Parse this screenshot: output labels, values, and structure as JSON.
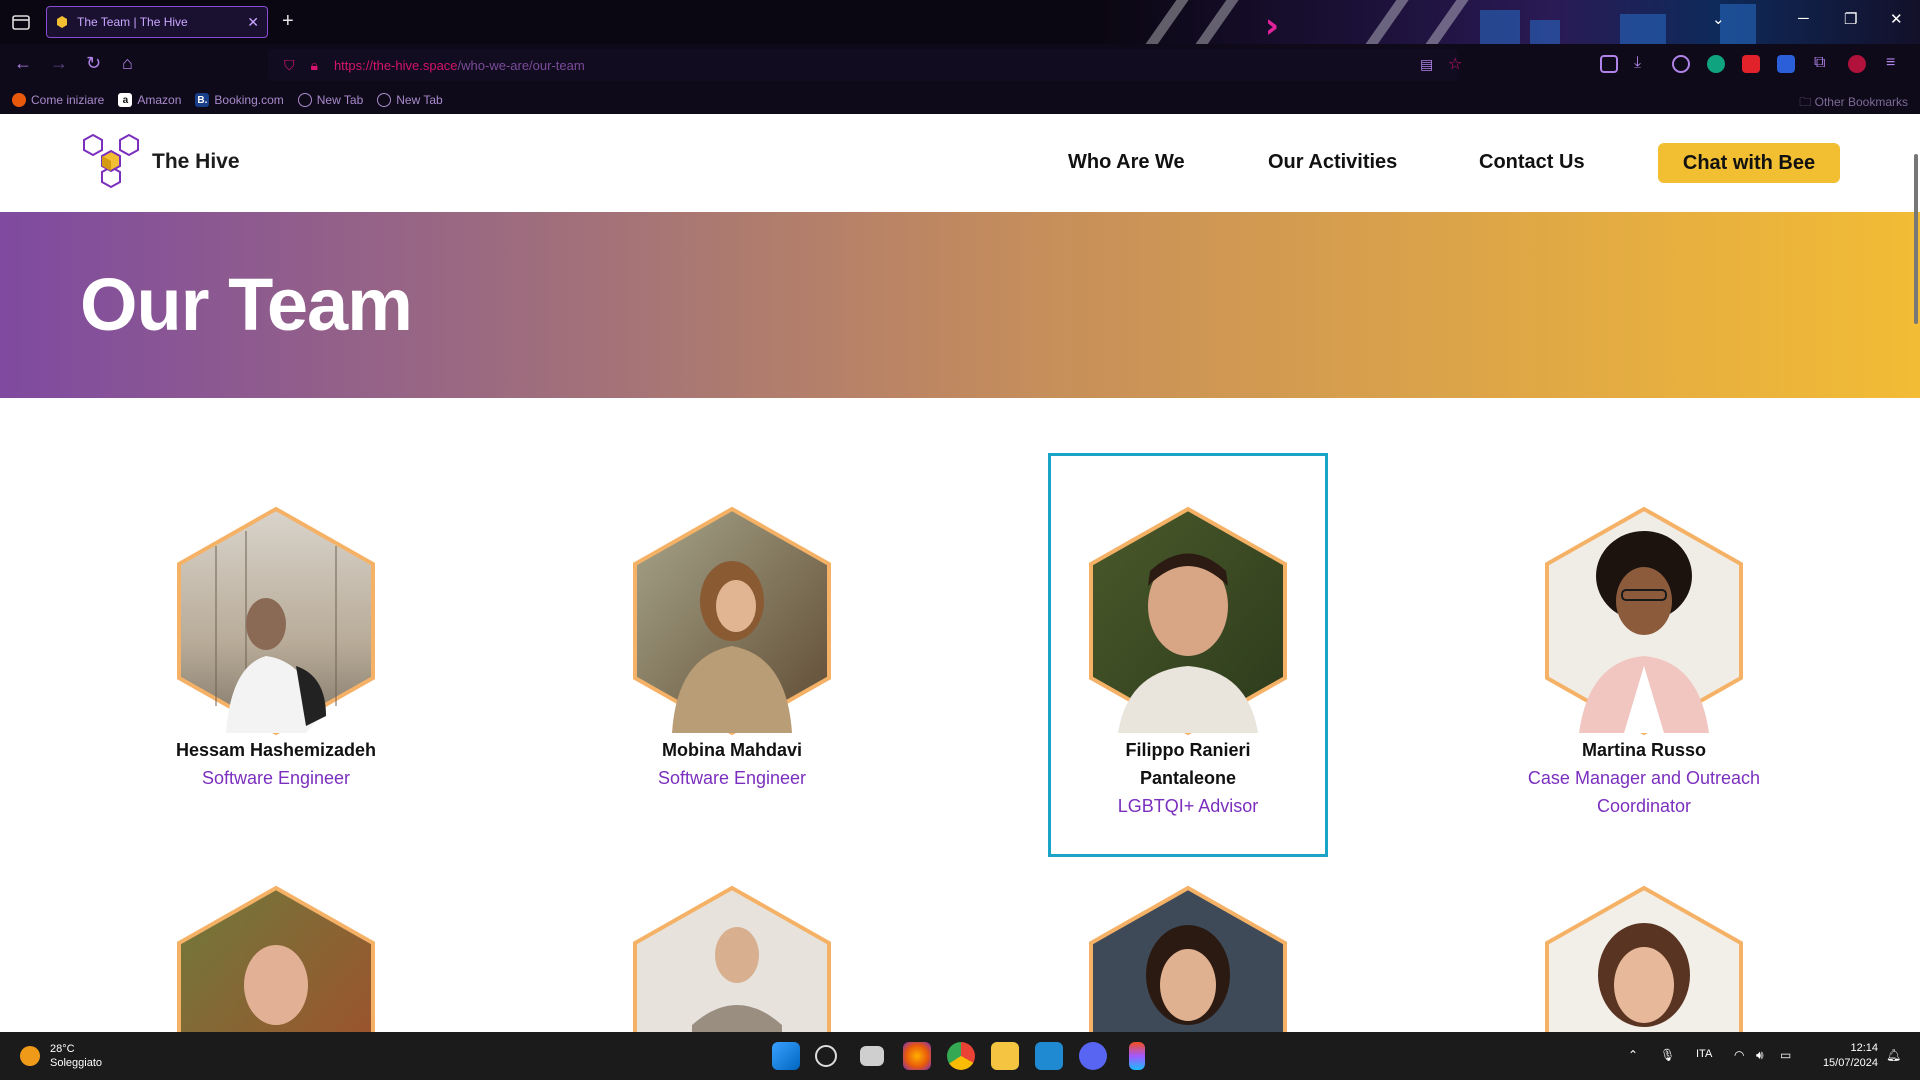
{
  "browser": {
    "tab_title": "The Team | The Hive",
    "tab_close": "✕",
    "new_tab": "+",
    "url_host": "https://the-hive.space",
    "url_path": "/who-we-are/our-team",
    "bookmarks": [
      {
        "label": "Come iniziare",
        "icon": "firefox-icon",
        "icon_char": "",
        "color": "#e8590c"
      },
      {
        "label": "Amazon",
        "icon": "amazon-icon",
        "icon_char": "a",
        "color": "#ffffff"
      },
      {
        "label": "Booking.com",
        "icon": "booking-icon",
        "icon_char": "B.",
        "color": "#1a3f8a"
      },
      {
        "label": "New Tab",
        "icon": "globe-icon",
        "icon_char": "🌐",
        "color": "transparent"
      },
      {
        "label": "New Tab",
        "icon": "globe-icon",
        "icon_char": "🌐",
        "color": "transparent"
      }
    ],
    "other_bookmarks": "Other Bookmarks"
  },
  "site": {
    "logo_text": "The Hive",
    "nav": [
      "Who Are We",
      "Our Activities",
      "Contact Us"
    ],
    "cta": "Chat with Bee",
    "page_title": "Our Team"
  },
  "team": [
    {
      "name": "Hessam Hashemizadeh",
      "role": "Software Engineer"
    },
    {
      "name": "Mobina Mahdavi",
      "role": "Software Engineer"
    },
    {
      "name": "Filippo Ranieri Pantaleone",
      "role": "LGBTQI+ Advisor"
    },
    {
      "name": "Martina Russo",
      "role": "Case Manager and Outreach Coordinator"
    }
  ],
  "taskbar": {
    "temperature": "28°C",
    "weather": "Soleggiato",
    "language": "ITA",
    "time": "12:14",
    "date": "15/07/2024"
  },
  "colors": {
    "accent_purple": "#7b2fbe",
    "accent_yellow": "#f2bf33",
    "hex_border": "#f5b266",
    "selection": "#1aa4c8"
  }
}
